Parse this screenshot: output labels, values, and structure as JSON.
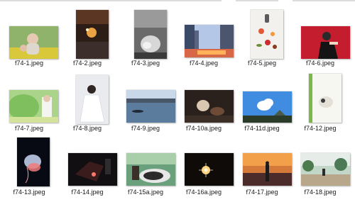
{
  "files": [
    {
      "name": "f74-1.jpeg"
    },
    {
      "name": "f74-2.jpeg"
    },
    {
      "name": "f74-3.jpeg"
    },
    {
      "name": "f74-4.jpeg"
    },
    {
      "name": "f74-5.jpeg"
    },
    {
      "name": "f74-6.jpeg"
    },
    {
      "name": "f74-7.jpeg"
    },
    {
      "name": "f74-8.jpeg"
    },
    {
      "name": "f74-9.jpeg"
    },
    {
      "name": "f74-10a.jpeg"
    },
    {
      "name": "f74-11d.jpeg"
    },
    {
      "name": "f74-12.jpeg"
    },
    {
      "name": "f74-13.jpeg"
    },
    {
      "name": "f74-14.jpeg"
    },
    {
      "name": "f74-15a.jpeg"
    },
    {
      "name": "f74-16a.jpeg"
    },
    {
      "name": "f74-17.jpeg"
    },
    {
      "name": "f74-18.jpeg"
    }
  ]
}
